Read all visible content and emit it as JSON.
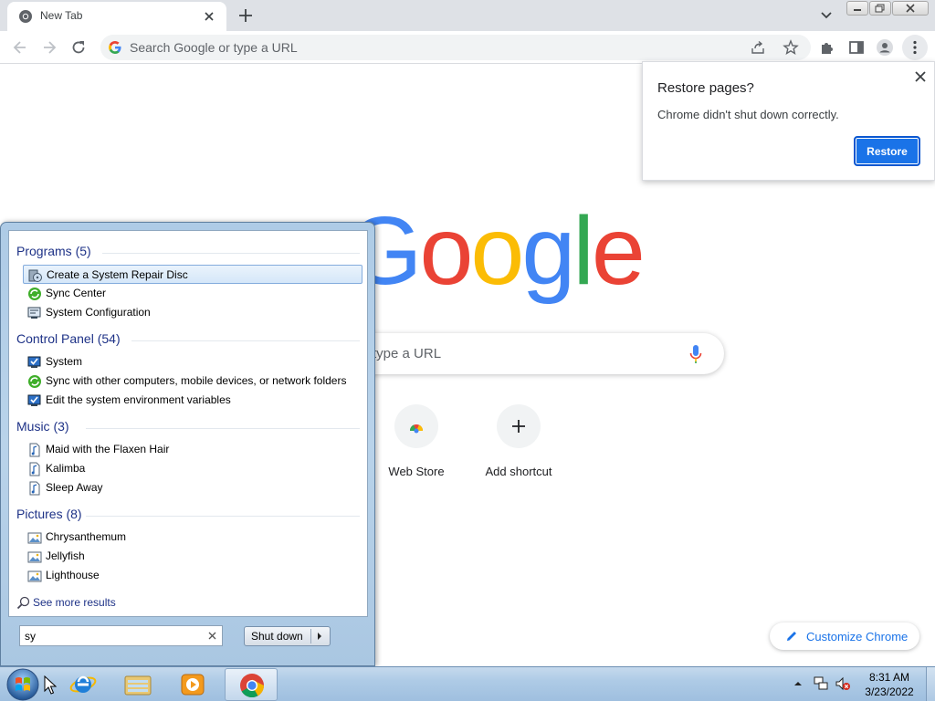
{
  "tab": {
    "title": "New Tab",
    "close_icon": "close-icon"
  },
  "toolbar": {
    "omnibox_placeholder": "Search Google or type a URL"
  },
  "ntp": {
    "logo_letters": [
      "G",
      "o",
      "o",
      "g",
      "l",
      "e"
    ],
    "logo_colors": [
      "#4285f4",
      "#ea4335",
      "#fbbc05",
      "#4285f4",
      "#34a853",
      "#ea4335"
    ],
    "search_placeholder_visible": "type a URL",
    "shortcuts": [
      {
        "label": "Web Store",
        "icon": "web-store-icon"
      },
      {
        "label": "Add shortcut",
        "icon": "plus-icon"
      }
    ],
    "customize_label": "Customize Chrome"
  },
  "restore_popup": {
    "heading": "Restore pages?",
    "message": "Chrome didn't shut down correctly.",
    "button": "Restore"
  },
  "start_menu": {
    "groups": [
      {
        "title": "Programs (5)",
        "items": [
          {
            "label": "Create a System Repair Disc",
            "icon": "repair-disc-icon",
            "selected": true
          },
          {
            "label": "Sync Center",
            "icon": "sync-icon"
          },
          {
            "label": "System Configuration",
            "icon": "system-config-icon"
          }
        ]
      },
      {
        "title": "Control Panel (54)",
        "items": [
          {
            "label": "System",
            "icon": "system-icon"
          },
          {
            "label": "Sync with other computers, mobile devices, or network folders",
            "icon": "sync-icon"
          },
          {
            "label": "Edit the system environment variables",
            "icon": "system-icon"
          }
        ]
      },
      {
        "title": "Music (3)",
        "items": [
          {
            "label": "Maid with the Flaxen Hair",
            "icon": "music-file-icon"
          },
          {
            "label": "Kalimba",
            "icon": "music-file-icon"
          },
          {
            "label": "Sleep Away",
            "icon": "music-file-icon"
          }
        ]
      },
      {
        "title": "Pictures (8)",
        "items": [
          {
            "label": "Chrysanthemum",
            "icon": "picture-file-icon"
          },
          {
            "label": "Jellyfish",
            "icon": "picture-file-icon"
          },
          {
            "label": "Lighthouse",
            "icon": "picture-file-icon"
          }
        ]
      }
    ],
    "see_more": "See more results",
    "search_value": "sy",
    "shutdown_label": "Shut down"
  },
  "taskbar": {
    "items": [
      "internet-explorer-icon",
      "file-explorer-icon",
      "media-player-icon",
      "chrome-icon"
    ],
    "clock_time": "8:31 AM",
    "clock_date": "3/23/2022"
  },
  "colors": {
    "chrome_blue": "#1a73e8",
    "start_group_text": "#1e3287"
  }
}
